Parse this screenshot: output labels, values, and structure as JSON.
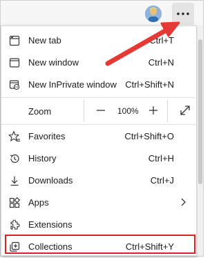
{
  "menu": {
    "items": [
      {
        "icon": "new-tab-icon",
        "label": "New tab",
        "shortcut": "Ctrl+T"
      },
      {
        "icon": "new-window-icon",
        "label": "New window",
        "shortcut": "Ctrl+N"
      },
      {
        "icon": "inprivate-window-icon",
        "label": "New InPrivate window",
        "shortcut": "Ctrl+Shift+N"
      },
      {
        "icon": "favorites-icon",
        "label": "Favorites",
        "shortcut": "Ctrl+Shift+O"
      },
      {
        "icon": "history-icon",
        "label": "History",
        "shortcut": "Ctrl+H"
      },
      {
        "icon": "downloads-icon",
        "label": "Downloads",
        "shortcut": "Ctrl+J"
      },
      {
        "icon": "apps-icon",
        "label": "Apps",
        "shortcut": ""
      },
      {
        "icon": "extensions-icon",
        "label": "Extensions",
        "shortcut": ""
      },
      {
        "icon": "collections-icon",
        "label": "Collections",
        "shortcut": "Ctrl+Shift+Y"
      }
    ],
    "zoom": {
      "label": "Zoom",
      "minus": "—",
      "value": "100%",
      "plus": "+"
    }
  },
  "colors": {
    "highlight": "#e02020",
    "arrow": "#e53935"
  }
}
